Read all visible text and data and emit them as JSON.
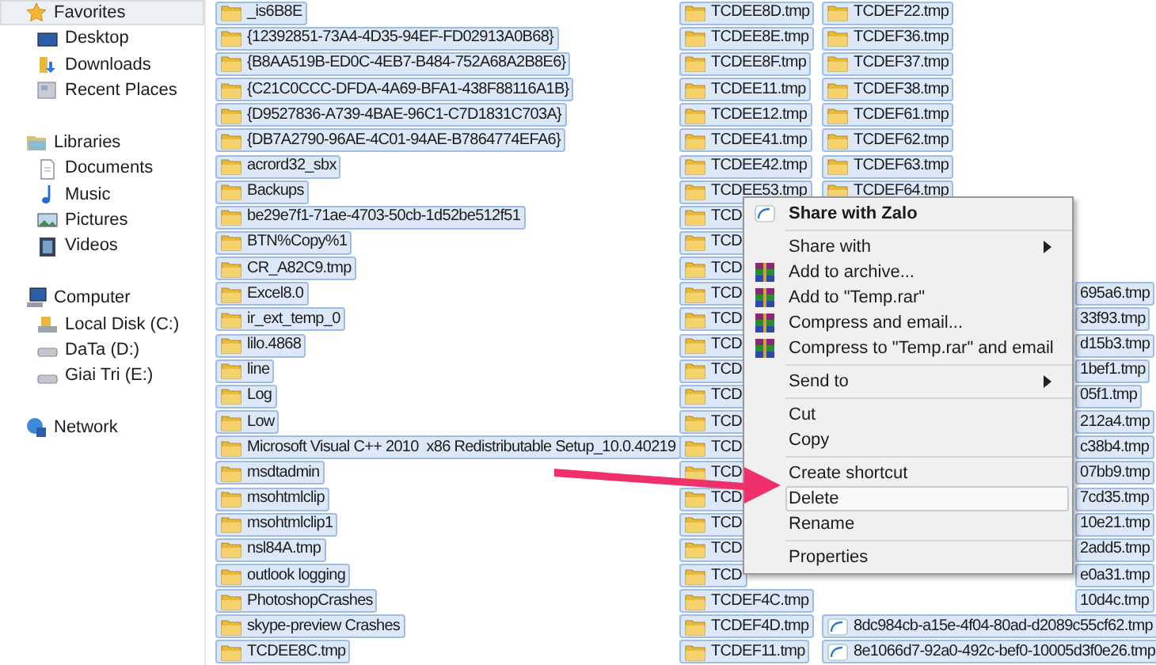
{
  "sidebar": {
    "groups": [
      {
        "label": "Favorites",
        "selected": true,
        "children": [
          {
            "label": "Desktop",
            "selected": false
          },
          {
            "label": "Downloads",
            "selected": false
          },
          {
            "label": "Recent Places",
            "selected": false
          }
        ]
      },
      {
        "label": "Libraries",
        "selected": false,
        "children": [
          {
            "label": "Documents",
            "selected": false
          },
          {
            "label": "Music",
            "selected": false
          },
          {
            "label": "Pictures",
            "selected": false
          },
          {
            "label": "Videos",
            "selected": false
          }
        ]
      },
      {
        "label": "Computer",
        "selected": false,
        "children": [
          {
            "label": "Local Disk (C:)",
            "selected": false
          },
          {
            "label": "DaTa (D:)",
            "selected": false
          },
          {
            "label": "Giai Tri (E:)",
            "selected": false
          }
        ]
      },
      {
        "label": "Network",
        "selected": false
      }
    ]
  },
  "files": {
    "columns": [
      {
        "items": [
          {
            "name": "_is6B8E",
            "kind": "folder",
            "selected": true
          },
          {
            "name": "{12392851-73A4-4D35-94EF-FD02913A0B68}",
            "kind": "folder",
            "selected": true
          },
          {
            "name": "{B8AA519B-ED0C-4EB7-B484-752A68A2B8E6}",
            "kind": "folder",
            "selected": true
          },
          {
            "name": "{C21C0CCC-DFDA-4A69-BFA1-438F88116A1B}",
            "kind": "folder",
            "selected": true
          },
          {
            "name": "{D9527836-A739-4BAE-96C1-C7D1831C703A}",
            "kind": "folder",
            "selected": true
          },
          {
            "name": "{DB7A2790-96AE-4C01-94AE-B7864774EFA6}",
            "kind": "folder",
            "selected": true
          },
          {
            "name": "acrord32_sbx",
            "kind": "folder",
            "selected": true
          },
          {
            "name": "Backups",
            "kind": "folder",
            "selected": true
          },
          {
            "name": "be29e7f1-71ae-4703-50cb-1d52be512f51",
            "kind": "folder",
            "selected": true
          },
          {
            "name": "BTN%Copy%1",
            "kind": "folder",
            "selected": true
          },
          {
            "name": "CR_A82C9.tmp",
            "kind": "folder",
            "selected": true
          },
          {
            "name": "Excel8.0",
            "kind": "folder",
            "selected": true
          },
          {
            "name": "ir_ext_temp_0",
            "kind": "folder",
            "selected": true
          },
          {
            "name": "lilo.4868",
            "kind": "folder",
            "selected": true
          },
          {
            "name": "line",
            "kind": "folder",
            "selected": true
          },
          {
            "name": "Log",
            "kind": "folder",
            "selected": true
          },
          {
            "name": "Low",
            "kind": "folder",
            "selected": true
          },
          {
            "name": "Microsoft Visual C++ 2010  x86 Redistributable Setup_10.0.40219",
            "kind": "folder",
            "selected": true
          },
          {
            "name": "msdtadmin",
            "kind": "folder",
            "selected": true
          },
          {
            "name": "msohtmlclip",
            "kind": "folder",
            "selected": true
          },
          {
            "name": "msohtmlclip1",
            "kind": "folder",
            "selected": true
          },
          {
            "name": "nsl84A.tmp",
            "kind": "folder",
            "selected": true
          },
          {
            "name": "outlook logging",
            "kind": "folder",
            "selected": true
          },
          {
            "name": "PhotoshopCrashes",
            "kind": "folder",
            "selected": true
          },
          {
            "name": "skype-preview Crashes",
            "kind": "folder",
            "selected": true
          },
          {
            "name": "TCDEE8C.tmp",
            "kind": "folder",
            "selected": true
          }
        ]
      },
      {
        "items": [
          {
            "name": "TCDEE8D.tmp",
            "kind": "folder",
            "selected": true
          },
          {
            "name": "TCDEE8E.tmp",
            "kind": "folder",
            "selected": true
          },
          {
            "name": "TCDEE8F.tmp",
            "kind": "folder",
            "selected": true
          },
          {
            "name": "TCDEE11.tmp",
            "kind": "folder",
            "selected": true
          },
          {
            "name": "TCDEE12.tmp",
            "kind": "folder",
            "selected": true
          },
          {
            "name": "TCDEE41.tmp",
            "kind": "folder",
            "selected": true
          },
          {
            "name": "TCDEE42.tmp",
            "kind": "folder",
            "selected": true
          },
          {
            "name": "TCDEE53.tmp",
            "kind": "folder",
            "selected": true
          },
          {
            "name": "TCD",
            "kind": "folder",
            "selected": true
          },
          {
            "name": "TCD",
            "kind": "folder",
            "selected": true
          },
          {
            "name": "TCD",
            "kind": "folder",
            "selected": true
          },
          {
            "name": "TCD",
            "kind": "folder",
            "selected": true
          },
          {
            "name": "TCD",
            "kind": "folder",
            "selected": true
          },
          {
            "name": "TCD",
            "kind": "folder",
            "selected": true
          },
          {
            "name": "TCD",
            "kind": "folder",
            "selected": true
          },
          {
            "name": "TCD",
            "kind": "folder",
            "selected": true
          },
          {
            "name": "TCD",
            "kind": "folder",
            "selected": true
          },
          {
            "name": "TCD",
            "kind": "folder",
            "selected": true
          },
          {
            "name": "TCD",
            "kind": "folder",
            "selected": true
          },
          {
            "name": "TCD",
            "kind": "folder",
            "selected": true
          },
          {
            "name": "TCD",
            "kind": "folder",
            "selected": true
          },
          {
            "name": "TCD",
            "kind": "folder",
            "selected": true
          },
          {
            "name": "TCD",
            "kind": "folder",
            "selected": true
          },
          {
            "name": "TCDEF4C.tmp",
            "kind": "folder",
            "selected": true
          },
          {
            "name": "TCDEF4D.tmp",
            "kind": "folder",
            "selected": true
          },
          {
            "name": "TCDEF11.tmp",
            "kind": "folder",
            "selected": true
          }
        ]
      },
      {
        "items": [
          {
            "name": "TCDEF22.tmp",
            "kind": "folder",
            "selected": true
          },
          {
            "name": "TCDEF36.tmp",
            "kind": "folder",
            "selected": true
          },
          {
            "name": "TCDEF37.tmp",
            "kind": "folder",
            "selected": true
          },
          {
            "name": "TCDEF38.tmp",
            "kind": "folder",
            "selected": true
          },
          {
            "name": "TCDEF61.tmp",
            "kind": "folder",
            "selected": true
          },
          {
            "name": "TCDEF62.tmp",
            "kind": "folder",
            "selected": true
          },
          {
            "name": "TCDEF63.tmp",
            "kind": "folder",
            "selected": true
          },
          {
            "name": "TCDEF64.tmp",
            "kind": "folder",
            "selected": true
          },
          {
            "kind": "hidden"
          },
          {
            "kind": "hidden"
          },
          {
            "kind": "hidden"
          },
          {
            "name": "695a6.tmp",
            "kind": "tail",
            "selected": true
          },
          {
            "name": "33f93.tmp",
            "kind": "tail",
            "selected": true
          },
          {
            "name": "d15b3.tmp",
            "kind": "tail",
            "selected": true
          },
          {
            "name": "1bef1.tmp",
            "kind": "tail",
            "selected": true
          },
          {
            "name": "05f1.tmp",
            "kind": "tail",
            "selected": true
          },
          {
            "name": "212a4.tmp",
            "kind": "tail",
            "selected": true
          },
          {
            "name": "c38b4.tmp",
            "kind": "tail",
            "selected": true
          },
          {
            "name": "07bb9.tmp",
            "kind": "tail",
            "selected": true
          },
          {
            "name": "7cd35.tmp",
            "kind": "tail",
            "selected": true
          },
          {
            "name": "10e21.tmp",
            "kind": "tail",
            "selected": true
          },
          {
            "name": "2add5.tmp",
            "kind": "tail",
            "selected": true
          },
          {
            "name": "e0a31.tmp",
            "kind": "tail",
            "selected": true
          },
          {
            "name": "10d4c.tmp",
            "kind": "tail",
            "selected": true
          },
          {
            "name": "8dc984cb-a15e-4f04-80ad-d2089c55cf62.tmp",
            "kind": "file",
            "selected": true
          },
          {
            "name": "8e1066d7-92a0-492c-bef0-10005d3f0e26.tmp",
            "kind": "file",
            "selected": true
          }
        ]
      }
    ]
  },
  "context_menu": {
    "groups": [
      [
        {
          "label": "Share with Zalo",
          "bold": true,
          "kind": "zalo",
          "submenu": false,
          "selected": false
        }
      ],
      [
        {
          "label": "Share with",
          "bold": false,
          "kind": "plain",
          "submenu": true,
          "selected": false
        },
        {
          "label": "Add to archive...",
          "bold": false,
          "kind": "archive",
          "submenu": false,
          "selected": false
        },
        {
          "label": "Add to \"Temp.rar\"",
          "bold": false,
          "kind": "archive",
          "submenu": false,
          "selected": false
        },
        {
          "label": "Compress and email...",
          "bold": false,
          "kind": "archive",
          "submenu": false,
          "selected": false
        },
        {
          "label": "Compress to \"Temp.rar\" and email",
          "bold": false,
          "kind": "archive",
          "submenu": false,
          "selected": false
        }
      ],
      [
        {
          "label": "Send to",
          "bold": false,
          "kind": "plain",
          "submenu": true,
          "selected": false
        }
      ],
      [
        {
          "label": "Cut",
          "bold": false,
          "kind": "plain",
          "submenu": false,
          "selected": false
        },
        {
          "label": "Copy",
          "bold": false,
          "kind": "plain",
          "submenu": false,
          "selected": false
        }
      ],
      [
        {
          "label": "Create shortcut",
          "bold": false,
          "kind": "plain",
          "submenu": false,
          "selected": false
        },
        {
          "label": "Delete",
          "bold": false,
          "kind": "plain",
          "submenu": false,
          "selected": true
        },
        {
          "label": "Rename",
          "bold": false,
          "kind": "plain",
          "submenu": false,
          "selected": false
        }
      ],
      [
        {
          "label": "Properties",
          "bold": false,
          "kind": "plain",
          "submenu": false,
          "selected": false
        }
      ]
    ]
  }
}
